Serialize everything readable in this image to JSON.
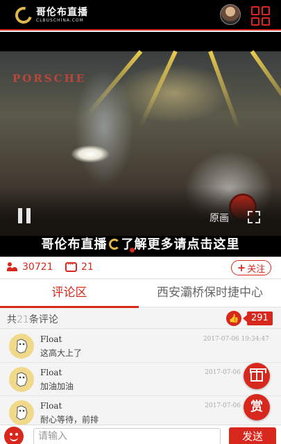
{
  "app": {
    "logo_cn": "哥伦布直播",
    "logo_en": "CLBUSCHINA.COM"
  },
  "video": {
    "overlay_brand": "PORSCHE",
    "quality_label": "原画",
    "banner_text": "哥伦布直播",
    "banner_text_after": "了解更多请点击这里"
  },
  "stats": {
    "viewers": "30721",
    "comments": "21",
    "follow_label": "关注"
  },
  "tabs": [
    {
      "label": "评论区",
      "active": true
    },
    {
      "label": "西安灞桥保时捷中心",
      "active": false
    }
  ],
  "comment_summary": {
    "prefix": "共",
    "count": "21",
    "suffix": "条评论",
    "likes": "291"
  },
  "comments": [
    {
      "name": "Float",
      "time": "2017-07-06 19:34:47",
      "text": "这高大上了"
    },
    {
      "name": "Float",
      "time": "2017-07-06",
      "text": "加油加油"
    },
    {
      "name": "Float",
      "time": "2017-07-06",
      "text": "耐心等待，前排"
    }
  ],
  "actions": {
    "reward_label": "赏"
  },
  "input": {
    "placeholder": "请输入",
    "send_label": "发送"
  },
  "colors": {
    "accent": "#d8271c",
    "gold": "#e0b84a"
  }
}
